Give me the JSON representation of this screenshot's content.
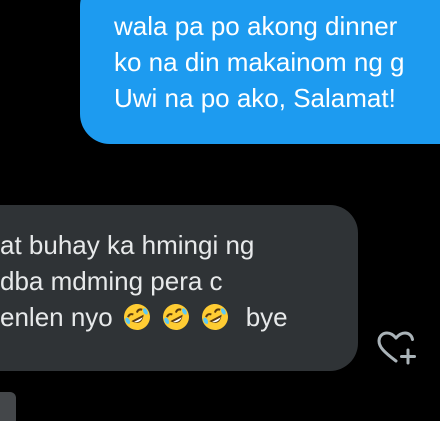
{
  "conversation": {
    "sent_message": {
      "lines": [
        "wala pa po akong dinner",
        "ko na din makainom ng g",
        "Uwi na po ako, Salamat!"
      ]
    },
    "received_message": {
      "lines": [
        "at buhay ka hmingi ng",
        "dba mdming pera c",
        "enlen nyo"
      ],
      "emoji": [
        "rolling-on-floor-laughing",
        "rolling-on-floor-laughing",
        "rolling-on-floor-laughing"
      ],
      "trailing_text": "bye"
    }
  },
  "colors": {
    "background": "#000000",
    "sent_bubble": "#1d9bf0",
    "received_bubble": "#2f3336",
    "text": "#ffffff",
    "icon": "#aab3b8"
  },
  "icons": {
    "add_reaction": "heart-plus-icon"
  }
}
